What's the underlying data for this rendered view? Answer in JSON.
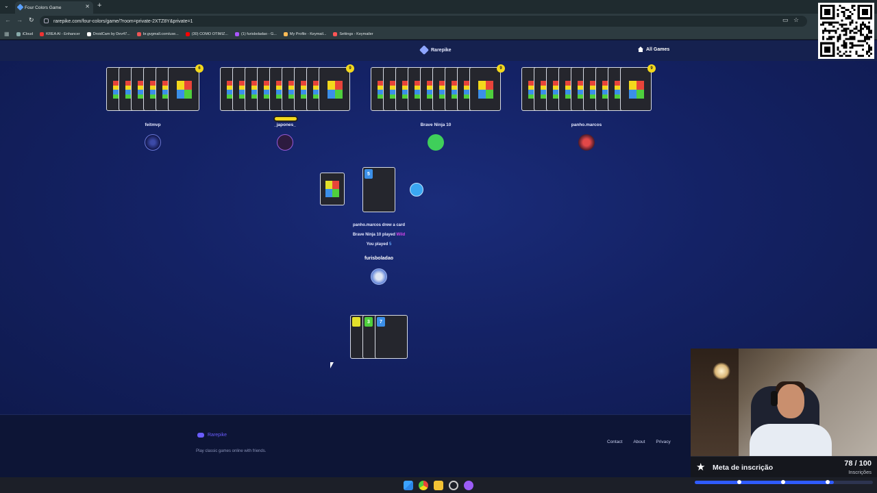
{
  "browser": {
    "tab_title": "Four Colors Game",
    "url": "rarepike.com/four-colors/game/?room=private-2XTZ8Y&private=1",
    "bookmarks": [
      "iCloud",
      "KREA AI - Enhancer",
      "DroidCam by Dev47...",
      "br.gvgmall.com/use...",
      "(30) COMO OTIMIZ...",
      "(1) furisboladao - G...",
      "My Profile - Keymail...",
      "Settings - Keymailer"
    ]
  },
  "site": {
    "brand": "Rarepike",
    "all_games": "All Games"
  },
  "opponents": [
    {
      "name": "feitmvp",
      "cards": "6"
    },
    {
      "name": "_japones_",
      "cards": "9"
    },
    {
      "name": "Brave Ninja 10",
      "cards": "9"
    },
    {
      "name": "panho.marcos",
      "cards": "9"
    }
  ],
  "table": {
    "pile_card": "5",
    "log": [
      {
        "text": "panho.marcos drew a card",
        "highlight": ""
      },
      {
        "text": "Brave Ninja 10 played ",
        "highlight": "Wild"
      },
      {
        "text": "You played ",
        "highlight": "5"
      }
    ]
  },
  "player": {
    "name": "furisboladao",
    "hand": [
      {
        "value": "",
        "color": "#e4e12a"
      },
      {
        "value": "3",
        "color": "#4fcf3d"
      },
      {
        "value": "7",
        "color": "#3b8fe8"
      }
    ]
  },
  "footer": {
    "brand": "Rarepike",
    "tagline": "Play classic games online with friends.",
    "links": [
      "Contact",
      "About",
      "Privacy"
    ]
  },
  "overlay": {
    "goal_title": "Meta de inscrição",
    "goal_count": "78 / 100",
    "goal_sub": "Inscrições",
    "goal_progress": 0.78
  },
  "colors": {
    "red": "#e8443a",
    "yellow": "#f3d81c",
    "green": "#4fcf3d",
    "blue": "#3b8fe8",
    "accent": "#6a5cff"
  }
}
